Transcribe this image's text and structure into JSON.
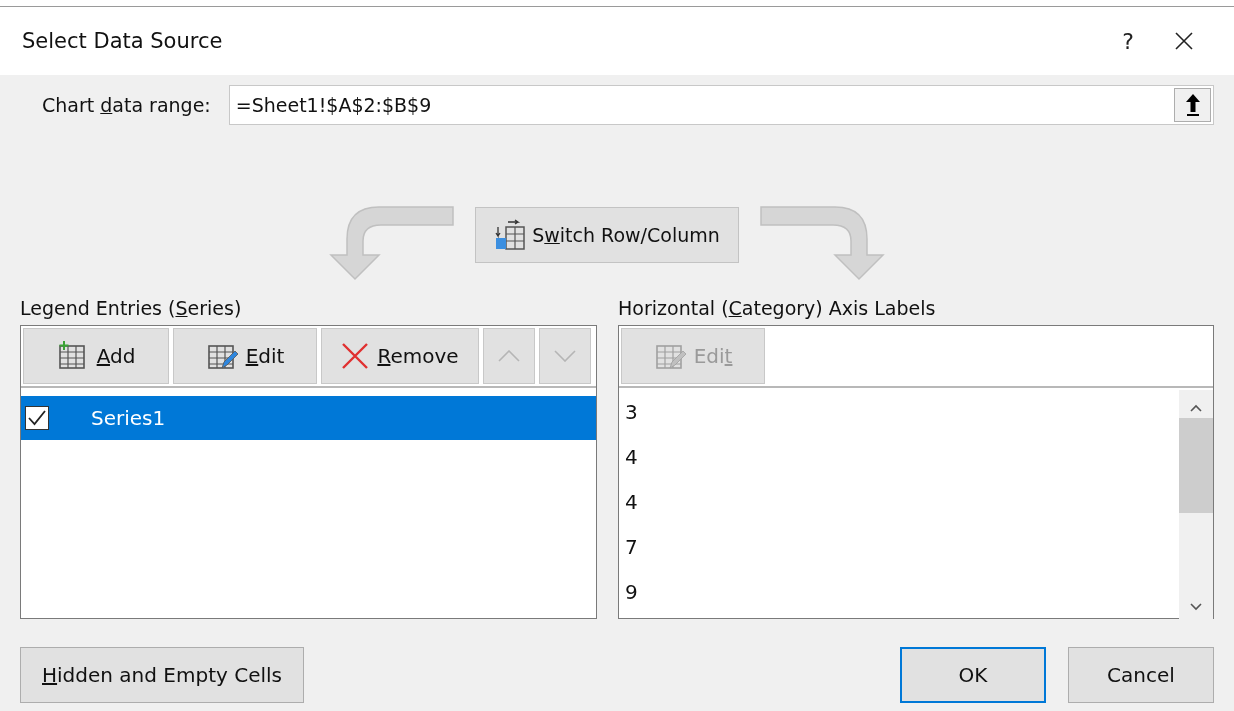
{
  "window": {
    "title": "Select Data Source",
    "help": "?"
  },
  "range": {
    "label": {
      "before": "Chart ",
      "key": "d",
      "after": "ata range:"
    },
    "value": "=Sheet1!$A$2:$B$9"
  },
  "switch_button": {
    "label": {
      "before": "S",
      "key": "w",
      "after": "itch Row/Column"
    }
  },
  "legend": {
    "title": {
      "before": "Legend Entries (",
      "key": "S",
      "after": "eries)"
    },
    "toolbar": [
      {
        "kind": "add",
        "label": {
          "key": "A",
          "after": "dd"
        },
        "disabled": false
      },
      {
        "kind": "edit",
        "label": {
          "key": "E",
          "after": "dit"
        },
        "disabled": false
      },
      {
        "kind": "remove",
        "label": {
          "key": "R",
          "after": "emove"
        },
        "disabled": false
      },
      {
        "kind": "up",
        "disabled": true
      },
      {
        "kind": "down",
        "disabled": true
      }
    ],
    "series": [
      {
        "name": "Series1",
        "checked": true,
        "selected": true
      }
    ]
  },
  "axis": {
    "title": {
      "before": "Horizontal (",
      "key": "C",
      "after": "ategory) Axis Labels"
    },
    "toolbar": [
      {
        "kind": "edit",
        "label": {
          "before": "Edi",
          "key": "t"
        },
        "disabled": true
      }
    ],
    "items": [
      "3",
      "4",
      "4",
      "7",
      "9"
    ]
  },
  "buttons": [
    {
      "kind": "plain",
      "label": {
        "key": "H",
        "after": "idden and Empty Cells"
      },
      "default": false
    },
    {
      "kind": "spacer"
    },
    {
      "kind": "plain",
      "label": {
        "before": "OK"
      },
      "default": true
    },
    {
      "kind": "plain",
      "label": {
        "before": "Cancel"
      },
      "default": false
    }
  ]
}
